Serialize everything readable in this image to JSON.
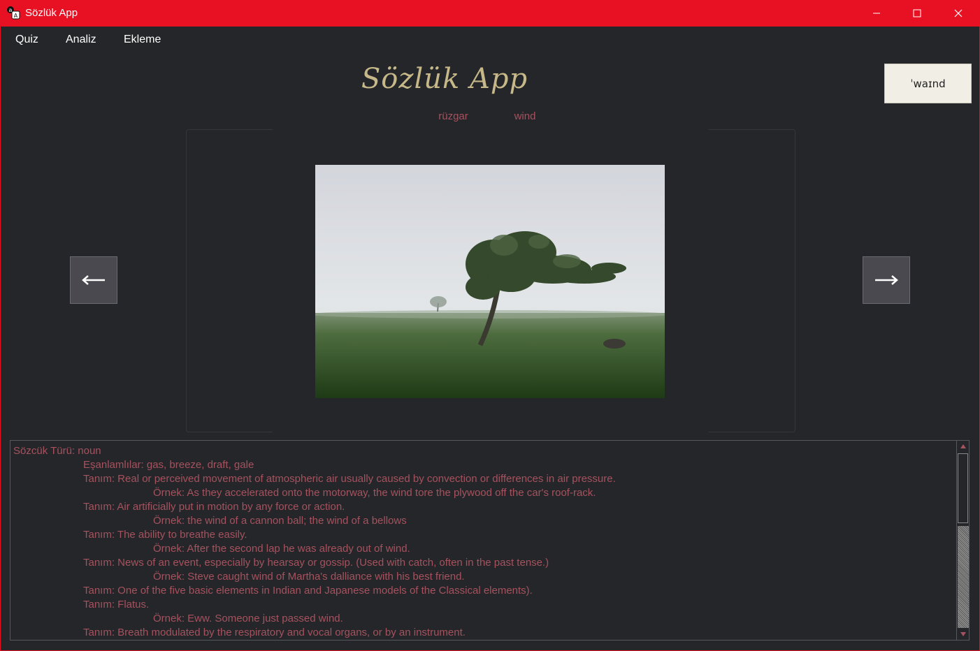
{
  "window": {
    "title": "Sözlük App",
    "accent_color": "#e81123"
  },
  "menu": {
    "items": [
      "Quiz",
      "Analiz",
      "Ekleme"
    ]
  },
  "header": {
    "app_title": "Sözlük App",
    "word_turkish": "rüzgar",
    "word_english": "wind",
    "pronunciation": "ˈwaɪnd"
  },
  "image": {
    "description_icon": "windswept-tree-in-fog-photo"
  },
  "navigation": {
    "prev_icon": "arrow-left-icon",
    "next_icon": "arrow-right-icon"
  },
  "details": {
    "word_type_line": "Sözcük Türü: noun",
    "lines": [
      {
        "indent": 1,
        "text": "Eşanlamlılar: gas, breeze, draft, gale"
      },
      {
        "indent": 1,
        "text": "Tanım: Real or perceived movement of atmospheric air usually caused by convection or differences in air pressure."
      },
      {
        "indent": 2,
        "text": "Örnek: As they accelerated onto the motorway, the wind tore the plywood off the car's roof-rack."
      },
      {
        "indent": 1,
        "text": "Tanım: Air artificially put in motion by any force or action."
      },
      {
        "indent": 2,
        "text": "Örnek: the wind of a cannon ball;  the wind of a bellows"
      },
      {
        "indent": 1,
        "text": "Tanım: The ability to breathe easily."
      },
      {
        "indent": 2,
        "text": "Örnek: After the second lap he was already out of wind."
      },
      {
        "indent": 1,
        "text": "Tanım: News of an event, especially by hearsay or gossip. (Used with catch, often in the past tense.)"
      },
      {
        "indent": 2,
        "text": "Örnek: Steve caught wind of Martha's dalliance with his best friend."
      },
      {
        "indent": 1,
        "text": "Tanım: One of the five basic elements in Indian and Japanese models of the Classical elements)."
      },
      {
        "indent": 1,
        "text": "Tanım: Flatus."
      },
      {
        "indent": 2,
        "text": "Örnek: Eww. Someone just passed wind."
      },
      {
        "indent": 1,
        "text": "Tanım: Breath modulated by the respiratory and vocal organs, or by an instrument."
      }
    ],
    "text_color": "#a6525f"
  }
}
